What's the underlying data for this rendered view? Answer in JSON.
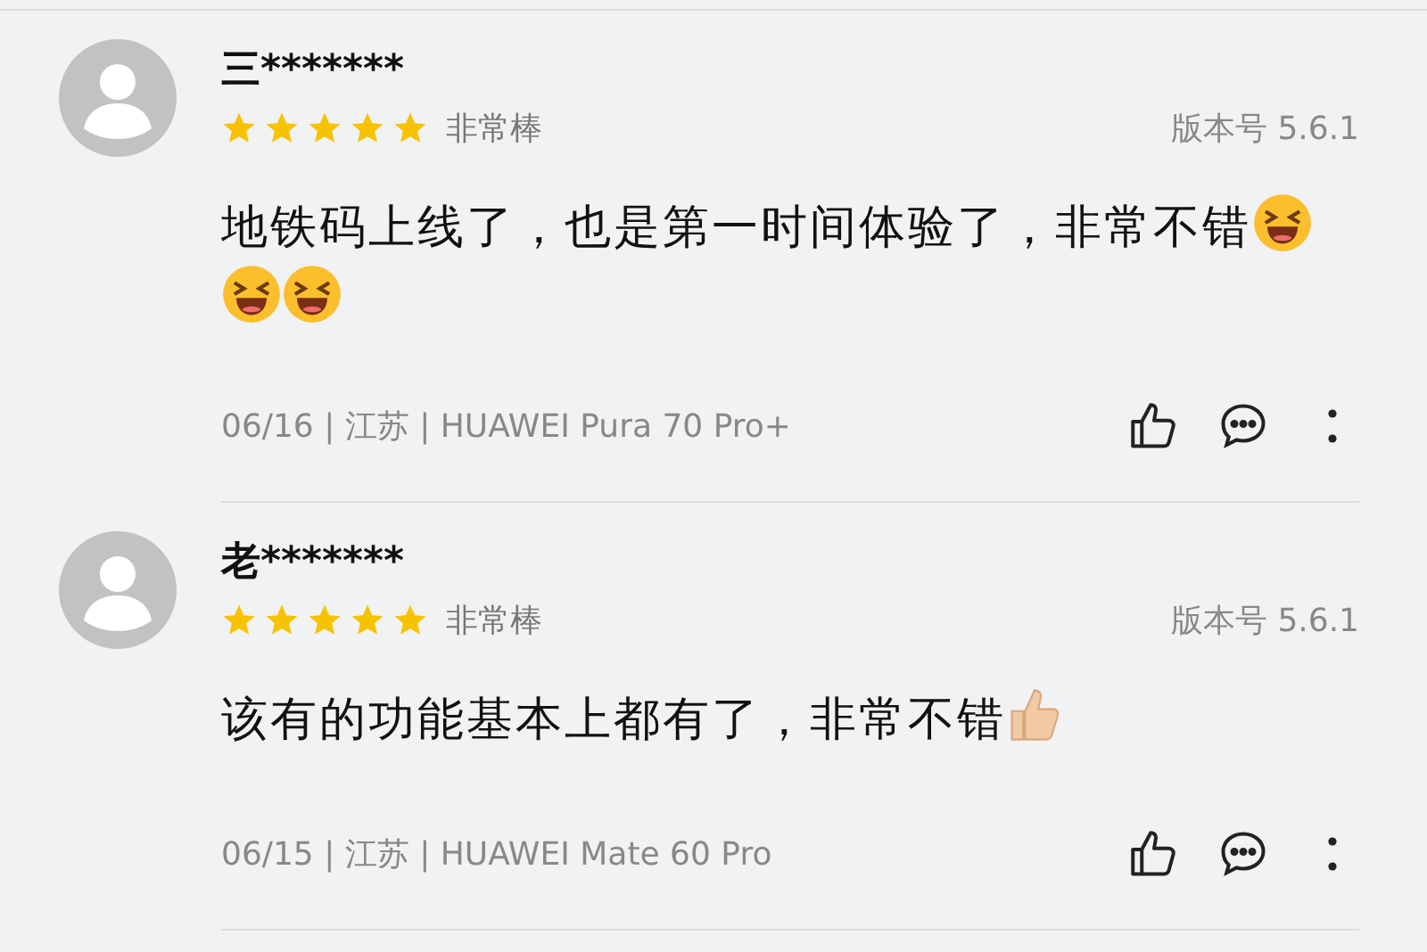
{
  "reviews": [
    {
      "user": "三*******",
      "stars": 5,
      "rating_label": "非常棒",
      "version": "版本号 5.6.1",
      "content": "地铁码上线了，也是第一时间体验了，非常不错",
      "emojis": [
        {
          "kind": "laughing"
        },
        {
          "kind": "laughing"
        },
        {
          "kind": "laughing"
        }
      ],
      "meta": "06/16 | 江苏 | HUAWEI Pura 70 Pro+"
    },
    {
      "user": "老*******",
      "stars": 5,
      "rating_label": "非常棒",
      "version": "版本号 5.6.1",
      "content": "该有的功能基本上都有了，非常不错",
      "emojis": [
        {
          "kind": "thumbs"
        }
      ],
      "meta": "06/15 | 江苏 | HUAWEI Mate 60 Pro"
    }
  ]
}
